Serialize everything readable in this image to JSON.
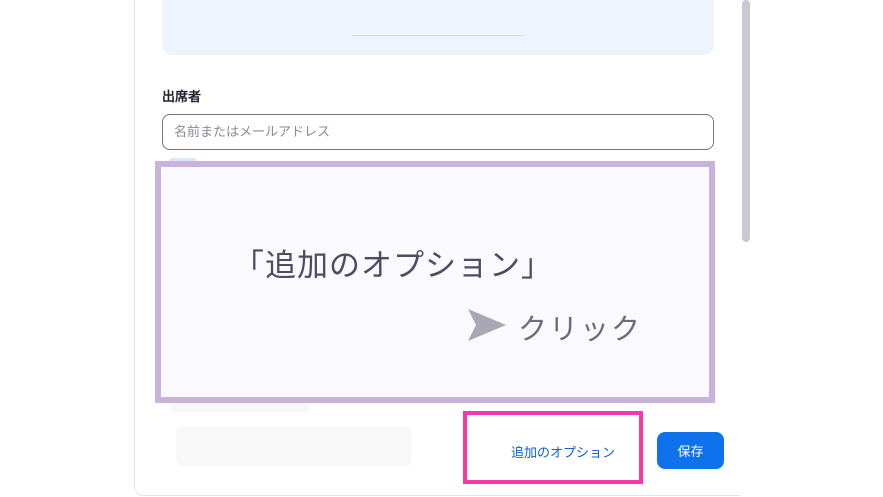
{
  "attendees": {
    "label": "出席者",
    "placeholder": "名前またはメールアドレス"
  },
  "callout": {
    "title": "「追加のオプション」",
    "click_label": "クリック",
    "arrow_icon": "arrow-pointer-icon",
    "border_color": "#c9b2dc",
    "arrow_color": "#a8a7b3"
  },
  "footer": {
    "options_label": "追加のオプション",
    "save_label": "保存",
    "highlight_color": "#f13aa7",
    "save_color": "#0e72ed",
    "link_color": "#0e5cd6"
  }
}
